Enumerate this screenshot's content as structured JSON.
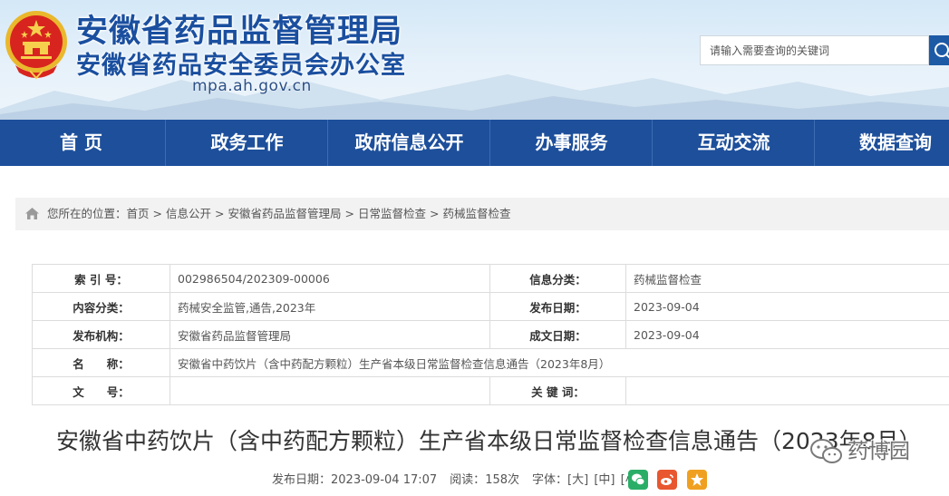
{
  "header": {
    "title_main": "安徽省药品监督管理局",
    "title_sub": "安徽省药品安全委员会办公室",
    "domain": "mpa.ah.gov.cn",
    "emblem_icon": "national-emblem-icon"
  },
  "search": {
    "placeholder": "请输入需要查询的关键词",
    "button_icon": "search-icon",
    "button_color": "#1d5aa6"
  },
  "nav": {
    "background": "#1d4f9b",
    "items": [
      {
        "label": "首 页"
      },
      {
        "label": "政务工作"
      },
      {
        "label": "政府信息公开"
      },
      {
        "label": "办事服务"
      },
      {
        "label": "互动交流"
      },
      {
        "label": "数据查询"
      }
    ]
  },
  "breadcrumb": {
    "home_icon": "home-icon",
    "prefix": "您所在的位置：",
    "separator": ">",
    "items": [
      {
        "label": "首页"
      },
      {
        "label": "信息公开"
      },
      {
        "label": "安徽省药品监督管理局"
      },
      {
        "label": "日常监督检查"
      },
      {
        "label": "药械监督检查"
      }
    ]
  },
  "info_table": {
    "rows": [
      {
        "label1": "索 引 号：",
        "value1": "002986504/202309-00006",
        "label2": "信息分类：",
        "value2": "药械监督检查"
      },
      {
        "label1": "内容分类：",
        "value1": "药械安全监管,通告,2023年",
        "label2": "发布日期：",
        "value2": "2023-09-04"
      },
      {
        "label1": "发布机构：",
        "value1": "安徽省药品监督管理局",
        "label2": "成文日期：",
        "value2": "2023-09-04"
      }
    ],
    "name_row": {
      "label": "名　　称：",
      "value": "安徽省中药饮片（含中药配方颗粒）生产省本级日常监督检查信息通告（2023年8月）"
    },
    "doc_row": {
      "label1": "文　　号：",
      "value1": "",
      "label2": "关 键 词：",
      "value2": ""
    }
  },
  "article": {
    "title": "安徽省中药饮片（含中药配方颗粒）生产省本级日常监督检查信息通告（2023年8月）",
    "publish_label": "发布日期：",
    "publish_datetime": "2023-09-04 17:07",
    "read_label": "阅读：",
    "read_count": "158",
    "read_unit": "次",
    "font_label": "字体：",
    "font_sizes": [
      "[大]",
      "[中]",
      "[小]"
    ],
    "share": [
      {
        "icon": "wechat-icon",
        "color": "#2aae67"
      },
      {
        "icon": "weibo-icon",
        "color": "#e8572f"
      },
      {
        "icon": "favorite-star-icon",
        "color": "#f0a020"
      }
    ]
  },
  "watermark": {
    "icon": "wechat-watermark-icon",
    "text": "药博园"
  }
}
